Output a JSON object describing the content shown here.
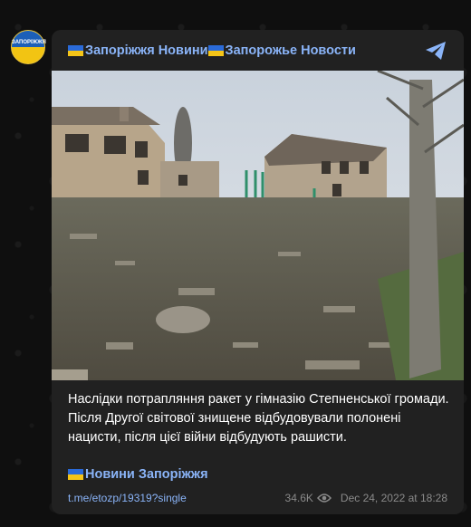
{
  "channel": {
    "name": "Запоріжжя Новини🇺🇦Запорожье Новости",
    "name_part1": "Запоріжжя Новини",
    "name_part2": "Запорожье Новости",
    "avatar_text": "ЗАПОРІЖЖЯ"
  },
  "post": {
    "caption": "Наслідки потрапляння ракет у гімназію Степненської громади. Після Другої світової знищене відбудовували полонені нацисти, після цієї війни відбудують рашисти.",
    "signature": "Новини Запоріжжя",
    "url": "t.me/etozp/19319?single",
    "views": "34.6K",
    "date": "Dec 24, 2022 at 18:28"
  },
  "colors": {
    "background": "#0f0f0f",
    "card": "#212121",
    "accent": "#8ab4f8",
    "text": "#ffffff",
    "muted": "#8a8a8a"
  },
  "icons": {
    "share": "share-arrow-icon",
    "views": "eye-icon",
    "flag": "ukraine-flag-icon"
  }
}
